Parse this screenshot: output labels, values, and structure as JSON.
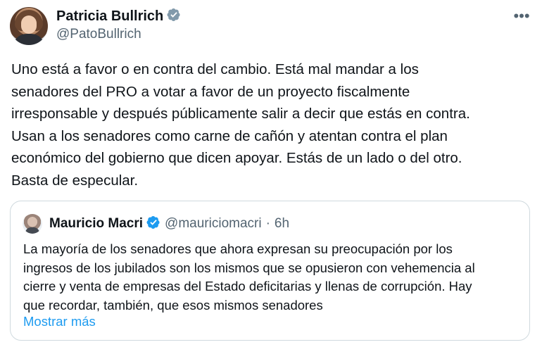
{
  "author": {
    "name": "Patricia Bullrich",
    "handle": "@PatoBullrich",
    "verified": true
  },
  "tweet": {
    "text": "Uno está a favor o en contra del cambio. Está mal mandar a los\nsenadores del PRO a votar a favor de un proyecto fiscalmente\nirresponsable y después públicamente salir a decir que estás en contra.\nUsan a los senadores como carne de cañón y atentan contra el plan\neconómico del gobierno que dicen apoyar. Estás de un lado o del otro.\nBasta de especular."
  },
  "more_menu": {
    "label": "•••"
  },
  "quoted_tweet": {
    "author_name": "Mauricio Macri",
    "handle": "@mauriciomacri",
    "separator": "·",
    "time": "6h",
    "text": "La mayoría de los senadores que ahora expresan su preocupación por los\ningresos de los jubilados son los mismos que se opusieron con vehemencia al\ncierre y venta de empresas del Estado deficitarias y llenas de corrupción. Hay\nque recordar, también, que esos mismos senadores",
    "show_more": "Mostrar más"
  },
  "colors": {
    "text": "#0f1419",
    "secondary": "#536471",
    "link": "#1d9bf0",
    "verified": "#1d9bf0",
    "border": "#cfd9de"
  }
}
